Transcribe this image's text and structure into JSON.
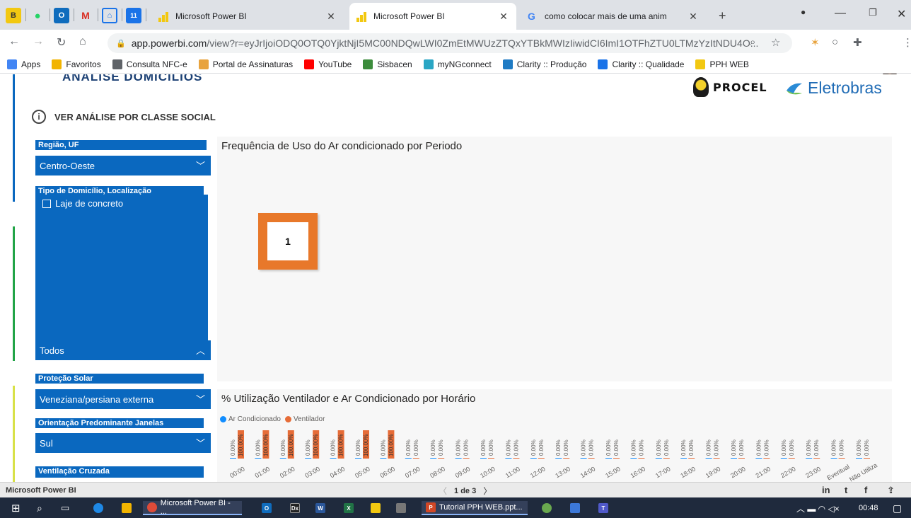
{
  "browser": {
    "tabs": [
      {
        "title": "Microsoft Power BI",
        "active": false
      },
      {
        "title": "Microsoft Power BI",
        "active": true
      },
      {
        "title": "como colocar mais de uma anim",
        "active": false
      }
    ],
    "new_tab": "+",
    "url_host": "app.powerbi.com",
    "url_path": "/view?r=eyJrIjoiODQ0OTQ0YjktNjI5MC00NDQwLWI0ZmEtMWUzZTQxYTBkMWIzIiwidCI6ImI1OTFhZTU0LTMzYzItNDU4O..."
  },
  "bookmarks": [
    {
      "label": "Apps",
      "color": "#4285f4"
    },
    {
      "label": "Favoritos",
      "color": "#f2b400"
    },
    {
      "label": "Consulta NFC-e",
      "color": "#5f6368"
    },
    {
      "label": "Portal de Assinaturas",
      "color": "#e8a33d"
    },
    {
      "label": "YouTube",
      "color": "#ff0000"
    },
    {
      "label": "Sisbacen",
      "color": "#3c8c3c"
    },
    {
      "label": "myNGconnect",
      "color": "#2aa6c4"
    },
    {
      "label": "Clarity :: Produção",
      "color": "#1f7bc4"
    },
    {
      "label": "Clarity :: Qualidade",
      "color": "#1a73e8"
    },
    {
      "label": "PPH WEB",
      "color": "#f2c811"
    }
  ],
  "report": {
    "cut_title": "ANÁLISE DOMICÍLIOS",
    "info_label": "VER ANÁLISE POR CLASSE SOCIAL",
    "logo_procel": "PROCEL",
    "logo_eletrobras": "Eletrobras",
    "slicers": {
      "regiao_label": "Região, UF",
      "regiao_value": "Centro-Oeste",
      "tipo_label": "Tipo de Domicílio, Localização",
      "tipo_option": "Laje de concreto",
      "todos_value": "Todos",
      "protecao_label": "Proteção Solar",
      "protecao_value": "Veneziana/persiana externa",
      "orientacao_label": "Orientação Predominante Janelas",
      "orientacao_value": "Sul",
      "ventilacao_label": "Ventilação Cruzada"
    },
    "chart1_title": "Frequência de Uso do Ar condicionado por Periodo",
    "callout_number": "1",
    "chart2_title": "% Utilização Ventilador e Ar Condicionado por Horário"
  },
  "chart_data": {
    "type": "bar",
    "title": "% Utilização Ventilador e Ar Condicionado por Horário",
    "categories": [
      "00:00",
      "01:00",
      "02:00",
      "03:00",
      "04:00",
      "05:00",
      "06:00",
      "07:00",
      "08:00",
      "09:00",
      "10:00",
      "11:00",
      "12:00",
      "13:00",
      "14:00",
      "15:00",
      "16:00",
      "17:00",
      "18:00",
      "19:00",
      "20:00",
      "21:00",
      "22:00",
      "23:00",
      "Eventual",
      "Não Utiliza"
    ],
    "series": [
      {
        "name": "Ar Condicionado",
        "color": "#118dff",
        "values": [
          0,
          0,
          0,
          0,
          0,
          0,
          0,
          0,
          0,
          0,
          0,
          0,
          0,
          0,
          0,
          0,
          0,
          0,
          0,
          0,
          0,
          0,
          0,
          0,
          0,
          0
        ],
        "labels": [
          "0.00%",
          "0.00%",
          "0.00%",
          "0.00%",
          "0.00%",
          "0.00%",
          "0.00%",
          "0.00%",
          "0.00%",
          "0.00%",
          "0.00%",
          "0.00%",
          "0.00%",
          "0.00%",
          "0.00%",
          "0.00%",
          "0.00%",
          "0.00%",
          "0.00%",
          "0.00%",
          "0.00%",
          "0.00%",
          "0.00%",
          "0.00%",
          "0.00%",
          "0.00%"
        ]
      },
      {
        "name": "Ventilador",
        "color": "#e66c37",
        "values": [
          100,
          100,
          100,
          100,
          100,
          100,
          100,
          0,
          0,
          0,
          0,
          0,
          0,
          0,
          0,
          0,
          0,
          0,
          0,
          0,
          0,
          0,
          0,
          0,
          0,
          0
        ],
        "labels": [
          "100.00%",
          "100.00%",
          "100.00%",
          "100.00%",
          "100.00%",
          "100.00%",
          "100.00%",
          "0.00%",
          "0.00%",
          "0.00%",
          "0.00%",
          "0.00%",
          "0.00%",
          "0.00%",
          "0.00%",
          "0.00%",
          "0.00%",
          "0.00%",
          "0.00%",
          "0.00%",
          "0.00%",
          "0.00%",
          "0.00%",
          "0.00%",
          "0.00%",
          "0.00%"
        ]
      }
    ],
    "legend": "top-left"
  },
  "footer": {
    "brand": "Microsoft Power BI",
    "pager": "1 de 3"
  },
  "taskbar": {
    "chrome_label": "Microsoft Power BI - ...",
    "ppt_label": "Tutorial PPH WEB.ppt...",
    "time": "00:48"
  }
}
